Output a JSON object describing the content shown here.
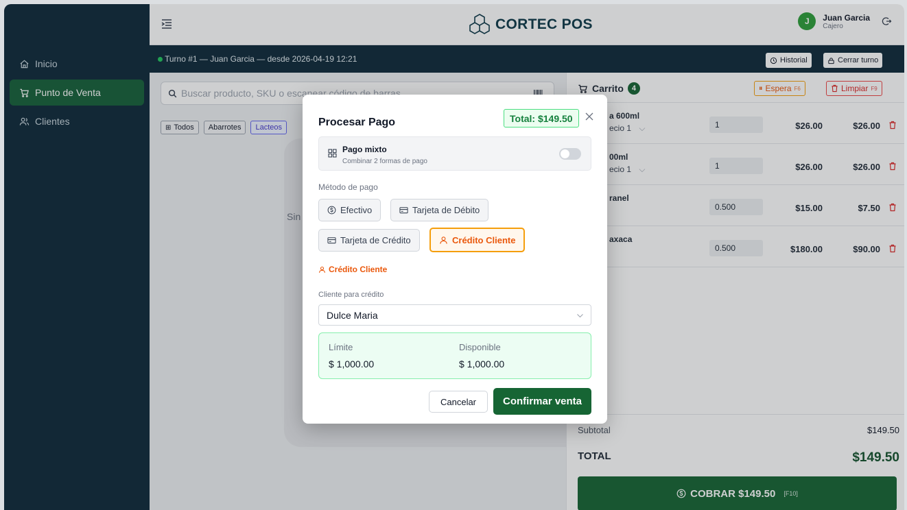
{
  "app": {
    "logo_text": "CORTEC POS"
  },
  "sidebar": {
    "items": [
      {
        "label": "Inicio",
        "icon": "home-icon"
      },
      {
        "label": "Punto de Venta",
        "icon": "cart-icon",
        "active": true
      },
      {
        "label": "Clientes",
        "icon": "users-icon"
      }
    ]
  },
  "user": {
    "initial": "J",
    "name": "Juan Garcia",
    "role": "Cajero"
  },
  "shift": {
    "text": "Turno #1 — Juan Garcia — desde 2026-04-19 12:21",
    "history_label": "Historial",
    "close_label": "Cerrar turno"
  },
  "main": {
    "search_placeholder": "Buscar producto, SKU o escanear código de barras",
    "categories": [
      "Todos",
      "Abarrotes",
      "Lacteos"
    ],
    "selected_category": "Lacteos",
    "empty_text": "Sin"
  },
  "cart": {
    "title": "Carrito",
    "count": "4",
    "hold_label": "Espera",
    "hold_key": "F6",
    "clear_label": "Limpiar",
    "clear_key": "F9",
    "rows": [
      {
        "name": "a 600ml",
        "sub": "ecio 1",
        "qty": "1",
        "price": "$26.00",
        "total": "$26.00"
      },
      {
        "name": "00ml",
        "sub": "ecio 1",
        "qty": "1",
        "price": "$26.00",
        "total": "$26.00"
      },
      {
        "name": "ranel",
        "sub": "",
        "qty": "0.500",
        "price": "$15.00",
        "total": "$7.50"
      },
      {
        "name": "axaca",
        "sub": "",
        "qty": "0.500",
        "price": "$180.00",
        "total": "$90.00"
      }
    ],
    "subtotal_label": "Subtotal",
    "subtotal_value": "$149.50",
    "total_label": "TOTAL",
    "total_value": "$149.50",
    "charge_label": "COBRAR $149.50",
    "charge_key": "[F10]"
  },
  "modal": {
    "title": "Procesar Pago",
    "total_badge": "Total: $149.50",
    "mixed_title": "Pago mixto",
    "mixed_subtitle": "Combinar 2 formas de pago",
    "method_label": "Método de pago",
    "methods": [
      "Efectivo",
      "Tarjeta de Débito",
      "Tarjeta de Crédito",
      "Crédito Cliente"
    ],
    "selected_method": "Crédito Cliente",
    "credit_tag": "Crédito Cliente",
    "client_label": "Cliente para crédito",
    "client_value": "Dulce Maria",
    "limit_label": "Límite",
    "limit_value": "$ 1,000.00",
    "available_label": "Disponible",
    "available_value": "$ 1,000.00",
    "cancel_label": "Cancelar",
    "confirm_label": "Confirmar venta"
  }
}
